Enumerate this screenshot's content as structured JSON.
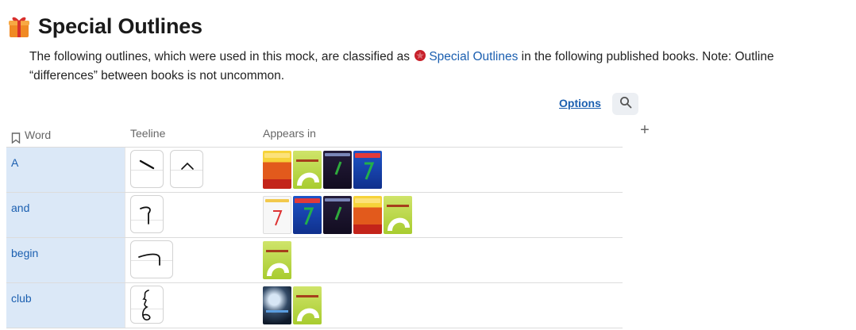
{
  "header": {
    "icon": "gift-icon",
    "title": "Special Outlines"
  },
  "intro": {
    "text_before": "The following outlines, which were used in this mock, are classified as",
    "link_icon": "star-icon",
    "link_text": "Special Outlines",
    "text_after": "in the following published books. Note: Outline “differences” between books is not uncommon."
  },
  "toolbar": {
    "options_label": "Options",
    "search_icon": "search-icon",
    "add_label": "+"
  },
  "table": {
    "headers": {
      "word": "Word",
      "teeline": "Teeline",
      "appears_in": "Appears in"
    },
    "rows": [
      {
        "word": "A",
        "outlines": [
          "a-outline-1",
          "a-outline-2"
        ],
        "books": [
          "red",
          "green",
          "dark",
          "blue"
        ]
      },
      {
        "word": "and",
        "outlines": [
          "and-outline"
        ],
        "books": [
          "white",
          "blue",
          "dark",
          "red",
          "green"
        ]
      },
      {
        "word": "begin",
        "outlines": [
          "begin-outline"
        ],
        "books": [
          "green"
        ]
      },
      {
        "word": "club",
        "outlines": [
          "club-outline"
        ],
        "books": [
          "photo",
          "green"
        ]
      }
    ]
  },
  "colors": {
    "link": "#1b5fb0",
    "word_cell_bg": "#dbe8f7",
    "accent_star": "#c8202a"
  }
}
